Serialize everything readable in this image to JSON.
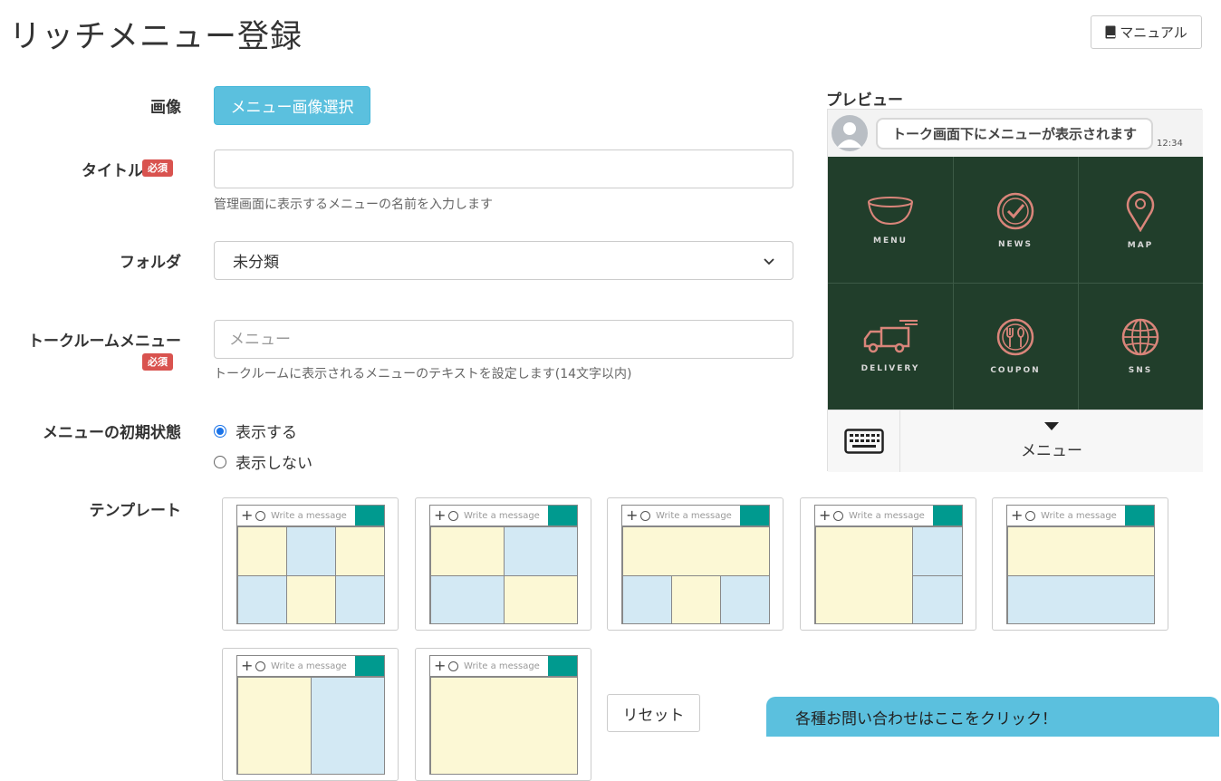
{
  "page": {
    "title": "リッチメニュー登録",
    "manual_label": "マニュアル"
  },
  "form": {
    "image": {
      "label": "画像",
      "button_label": "メニュー画像選択"
    },
    "title": {
      "label": "タイトル",
      "required_badge": "必須",
      "value": "",
      "help": "管理画面に表示するメニューの名前を入力します"
    },
    "folder": {
      "label": "フォルダ",
      "selected": "未分類"
    },
    "talkroom_menu": {
      "label": "トークルームメニュー",
      "required_badge": "必須",
      "value": "",
      "placeholder": "メニュー",
      "help": "トークルームに表示されるメニューのテキストを設定します(14文字以内)"
    },
    "initial_state": {
      "label": "メニューの初期状態",
      "options": [
        {
          "label": "表示する",
          "checked": true
        },
        {
          "label": "表示しない",
          "checked": false
        }
      ]
    },
    "template": {
      "label": "テンプレート",
      "bar_placeholder": "Write a message",
      "reset_label": "リセット",
      "colors": {
        "yellow": "#fcf8d5",
        "blue": "#d3e9f4",
        "send": "#009a8f"
      }
    }
  },
  "preview": {
    "title": "プレビュー",
    "chat_message": "トーク画面下にメニューが表示されます",
    "chat_time": "12:34",
    "menu_items": [
      {
        "label": "MENU",
        "icon": "bowl-icon"
      },
      {
        "label": "NEWS",
        "icon": "check-circle-icon"
      },
      {
        "label": "MAP",
        "icon": "map-pin-icon"
      },
      {
        "label": "DELIVERY",
        "icon": "truck-icon"
      },
      {
        "label": "COUPON",
        "icon": "cutlery-icon"
      },
      {
        "label": "SNS",
        "icon": "globe-icon"
      }
    ],
    "menu_bg_color": "#213e2b",
    "icon_color": "#d9857a",
    "menu_toggle_label": "メニュー"
  },
  "contact": {
    "label": "各種お問い合わせはここをクリック！"
  }
}
